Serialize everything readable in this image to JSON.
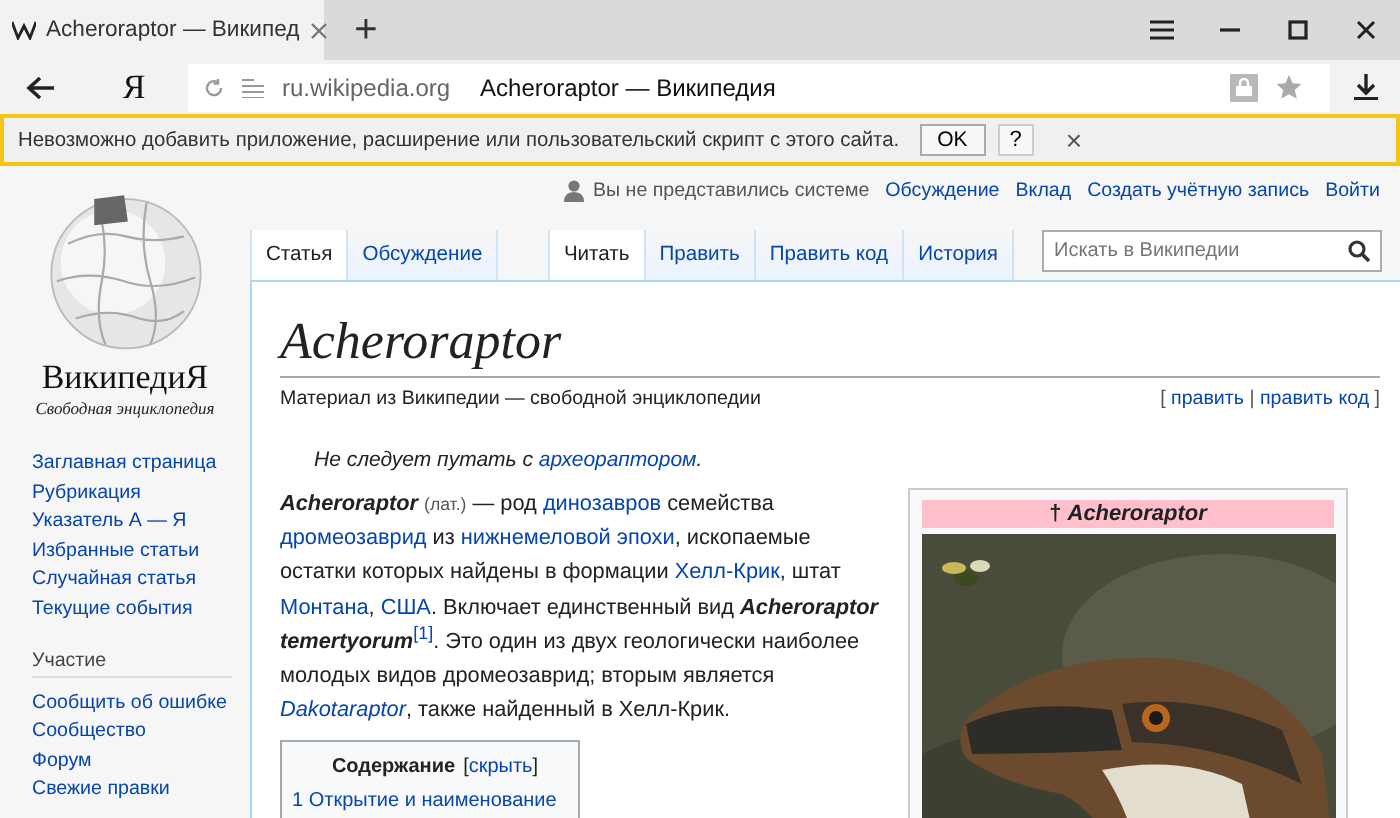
{
  "browser_tabs": [
    {
      "title": "Acheroraptor — Википед",
      "selected": true
    }
  ],
  "new_tab": "+",
  "toolbar": {
    "yandex_button": "Я"
  },
  "address_bar": {
    "domain": "ru.wikipedia.org",
    "page_title": "Acheroraptor — Википедия"
  },
  "infobar": {
    "message": "Невозможно добавить приложение, расширение или пользовательский скрипт с этого сайта.",
    "ok_button": "OK",
    "help_button": "?",
    "close": "×"
  },
  "personal_bar": {
    "status": "Вы не представились системе",
    "links": [
      "Обсуждение",
      "Вклад",
      "Создать учётную запись",
      "Войти"
    ]
  },
  "logo": {
    "wordmark": "ВикипедиЯ",
    "tagline": "Свободная энциклопедия"
  },
  "sidebar": {
    "items": [
      "Заглавная страница",
      "Рубрикация",
      "Указатель А — Я",
      "Избранные статьи",
      "Случайная статья",
      "Текущие события"
    ],
    "sections": [
      {
        "heading": "Участие",
        "items": [
          "Сообщить об ошибке",
          "Сообщество",
          "Форум",
          "Свежие правки"
        ]
      }
    ]
  },
  "namespace_tabs": [
    {
      "label": "Статья",
      "selected": true
    },
    {
      "label": "Обсуждение",
      "selected": false
    }
  ],
  "view_tabs": [
    {
      "label": "Читать",
      "selected": true
    },
    {
      "label": "Править",
      "selected": false
    },
    {
      "label": "Править код",
      "selected": false
    },
    {
      "label": "История",
      "selected": false
    }
  ],
  "search": {
    "placeholder": "Искать в Википедии"
  },
  "article": {
    "title": "Acheroraptor",
    "subtitle": "Материал из Википедии — свободной энциклопедии",
    "edit_links": [
      {
        "kind": "plain",
        "text": "[ "
      },
      {
        "kind": "link",
        "text": "править"
      },
      {
        "kind": "plain",
        "text": " | "
      },
      {
        "kind": "link",
        "text": "править код"
      },
      {
        "kind": "plain",
        "text": " ]"
      }
    ],
    "hatnote": [
      {
        "kind": "plain",
        "text": "Не следует путать с "
      },
      {
        "kind": "link",
        "text": "археораптором"
      },
      {
        "kind": "plain",
        "text": "."
      }
    ],
    "paragraph": [
      {
        "kind": "term",
        "text": "Acheroraptor"
      },
      {
        "kind": "lang",
        "text": "(лат.)"
      },
      {
        "kind": "plain",
        "text": " — род "
      },
      {
        "kind": "link",
        "text": "динозавров"
      },
      {
        "kind": "plain",
        "text": " семейства "
      },
      {
        "kind": "link",
        "text": "дромеозаврид"
      },
      {
        "kind": "plain",
        "text": " из "
      },
      {
        "kind": "link",
        "text": "нижнемеловой эпохи"
      },
      {
        "kind": "plain",
        "text": ", ископаемые остатки которых найдены в формации "
      },
      {
        "kind": "link",
        "text": "Хелл-Крик"
      },
      {
        "kind": "plain",
        "text": ", штат "
      },
      {
        "kind": "link",
        "text": "Монтана"
      },
      {
        "kind": "plain",
        "text": ", "
      },
      {
        "kind": "link",
        "text": "США"
      },
      {
        "kind": "plain",
        "text": ". Включает единственный вид "
      },
      {
        "kind": "term",
        "text": "Acheroraptor temertyorum"
      },
      {
        "kind": "ref",
        "text": "[1]"
      },
      {
        "kind": "plain",
        "text": ". Это один из двух геологически наиболее молодых видов дромеозаврид; вторым является "
      },
      {
        "kind": "italic-link",
        "text": "Dakotaraptor"
      },
      {
        "kind": "plain",
        "text": ", также найденный в Хелл-Крик."
      }
    ],
    "toc": {
      "title": "Содержание",
      "toggle": [
        {
          "kind": "plain",
          "text": "["
        },
        {
          "kind": "link",
          "text": "скрыть"
        },
        {
          "kind": "plain",
          "text": "]"
        }
      ],
      "items": [
        {
          "number": "1",
          "label": "Открытие и наименование"
        }
      ]
    },
    "infobox": {
      "title": "† *Acheroraptor*"
    }
  }
}
